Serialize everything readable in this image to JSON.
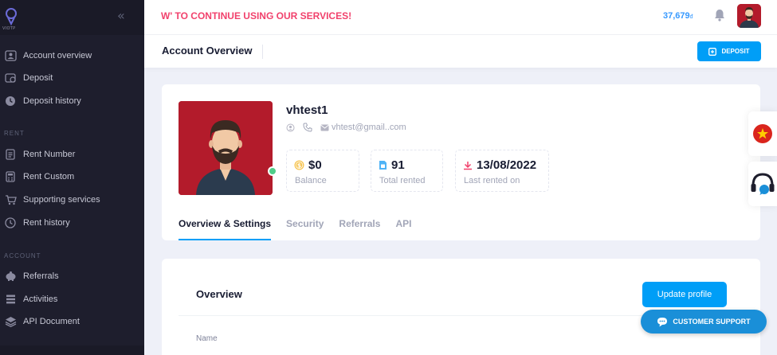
{
  "brand": {
    "logo_text": "VIOTP"
  },
  "sidebar": {
    "collapse_icon": "double-chevron-left-icon",
    "items_main": [
      {
        "label": "Account overview",
        "icon": "user-card-icon"
      },
      {
        "label": "Deposit",
        "icon": "wallet-icon"
      },
      {
        "label": "Deposit history",
        "icon": "clock-icon"
      }
    ],
    "section_rent": "RENT",
    "items_rent": [
      {
        "label": "Rent Number",
        "icon": "document-icon"
      },
      {
        "label": "Rent Custom",
        "icon": "calculator-icon"
      },
      {
        "label": "Supporting services",
        "icon": "cart-icon"
      },
      {
        "label": "Rent history",
        "icon": "clock-icon"
      }
    ],
    "section_account": "ACCOUNT",
    "items_account": [
      {
        "label": "Referrals",
        "icon": "piggy-bank-icon"
      },
      {
        "label": "Activities",
        "icon": "list-icon"
      },
      {
        "label": "API Document",
        "icon": "layers-icon"
      }
    ]
  },
  "header": {
    "marquee": "W' TO CONTINUE USING OUR SERVICES!",
    "balance": "37,679",
    "currency": "đ"
  },
  "toolbar": {
    "title": "Account Overview",
    "deposit_label": "DEPOSIT"
  },
  "profile": {
    "username": "vhtest1",
    "email": "vhtest@gmail..com",
    "stats": [
      {
        "value": "$0",
        "label": "Balance",
        "icon": "dollar-coin-icon"
      },
      {
        "value": "91",
        "label": "Total rented",
        "icon": "sim-card-icon"
      },
      {
        "value": "13/08/2022",
        "label": "Last rented on",
        "icon": "arrow-down-icon"
      }
    ]
  },
  "tabs": [
    "Overview & Settings",
    "Security",
    "Referrals",
    "API"
  ],
  "overview": {
    "title": "Overview",
    "update_label": "Update profile",
    "name_label": "Name"
  },
  "support": {
    "label": "CUSTOMER SUPPORT"
  },
  "colors": {
    "primary": "#009ef7",
    "sidebar": "#1e1e2d",
    "marquee": "#f1416c",
    "online": "#50cd89",
    "avatar_bg": "#b31b2b"
  }
}
